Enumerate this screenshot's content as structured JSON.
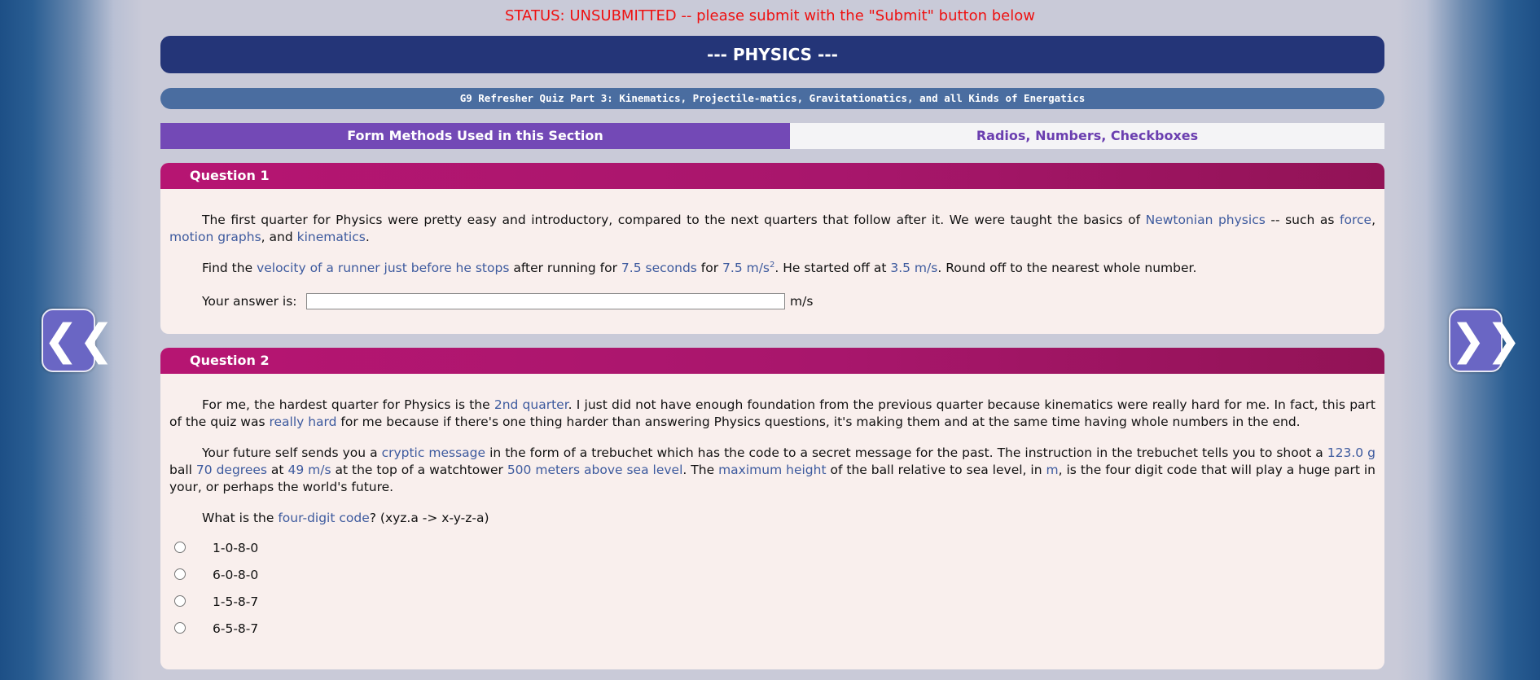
{
  "status": "STATUS: UNSUBMITTED -- please submit with the \"Submit\" button below",
  "section_title": "--- PHYSICS ---",
  "subtitle": "G9 Refresher Quiz Part 3: Kinematics, Projectile-matics, Gravitationatics, and all Kinds of Energatics",
  "methods": {
    "label": "Form Methods Used in this Section",
    "value": "Radios, Numbers, Checkboxes"
  },
  "nav": {
    "prev": "❮❮",
    "next": "❯❯"
  },
  "q1": {
    "title": "Question 1",
    "p1": [
      "The first quarter for Physics were pretty easy and introductory, compared to the next quarters that follow after it. We were taught the basics of ",
      "Newtonian physics",
      " -- such as ",
      "force",
      ", ",
      "motion graphs",
      ", and ",
      "kinematics",
      "."
    ],
    "p2": [
      "Find the ",
      "velocity of a runner just before he stops",
      " after running for ",
      "7.5 seconds",
      " for ",
      "7.5 m/s",
      "2",
      ". He started off at ",
      "3.5 m/s",
      ". Round off to the nearest whole number."
    ],
    "answer_label": "Your answer is:",
    "answer_value": "",
    "unit": "m/s"
  },
  "q2": {
    "title": "Question 2",
    "p1": [
      "For me, the hardest quarter for Physics is the ",
      "2nd quarter",
      ". I just did not have enough foundation from the previous quarter because kinematics were really hard for me. In fact, this part of the quiz was ",
      "really hard",
      " for me because if there's one thing harder than answering Physics questions, it's making them and at the same time having whole numbers in the end."
    ],
    "p2": [
      "Your future self sends you a ",
      "cryptic message",
      " in the form of a trebuchet which has the code to a secret message for the past. The instruction in the trebuchet tells you to shoot a ",
      "123.0 g",
      " ball ",
      "70 degrees",
      " at ",
      "49 m/s",
      " at the top of a watchtower ",
      "500 meters above sea level",
      ". The ",
      "maximum height",
      " of the ball relative to sea level, in ",
      "m",
      ", is the four digit code that will play a huge part in your, or perhaps the world's future."
    ],
    "p3": [
      "What is the ",
      "four-digit code",
      "? (xyz.a -> x-y-z-a)"
    ],
    "options": [
      "1-0-8-0",
      "6-0-8-0",
      "1-5-8-7",
      "6-5-8-7"
    ]
  },
  "colors": {
    "highlight": "#3d5a9e",
    "status": "#ee1111",
    "banner": "#243578",
    "question_header": "#b61572"
  }
}
